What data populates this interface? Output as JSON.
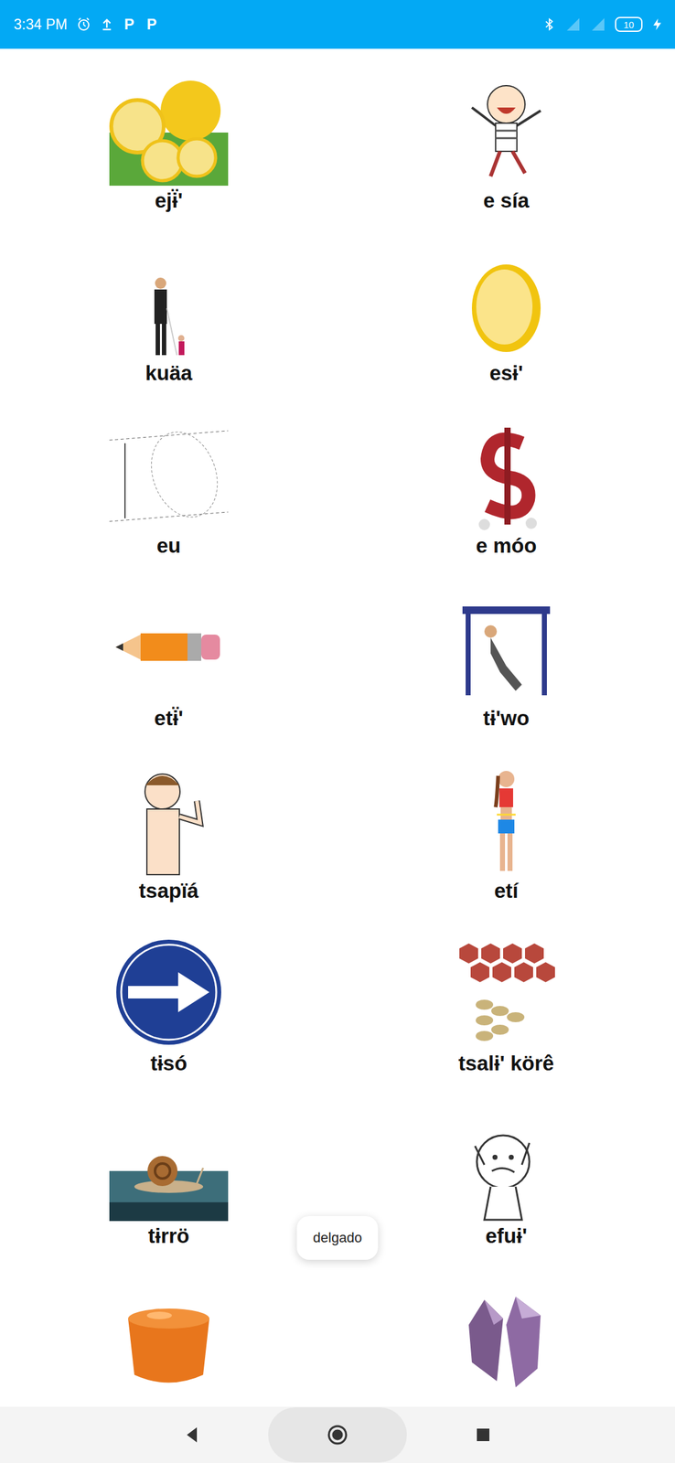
{
  "status_bar": {
    "time": "3:34 PM",
    "notification_icons": [
      "P",
      "P"
    ],
    "battery": "10",
    "charging": true
  },
  "items": [
    {
      "label": "ejɨ̈'"
    },
    {
      "label": "e sía"
    },
    {
      "label": "kuäa"
    },
    {
      "label": "esɨ'"
    },
    {
      "label": "eu"
    },
    {
      "label": "e móo"
    },
    {
      "label": "etɨ̈'"
    },
    {
      "label": "tɨ'wo"
    },
    {
      "label": "tsapïá"
    },
    {
      "label": "etí"
    },
    {
      "label": "tɨsó"
    },
    {
      "label": "tsalɨ' körê"
    },
    {
      "label": "tɨrrö"
    },
    {
      "label": "efuɨ'"
    },
    {},
    {}
  ],
  "toast": "delgado"
}
